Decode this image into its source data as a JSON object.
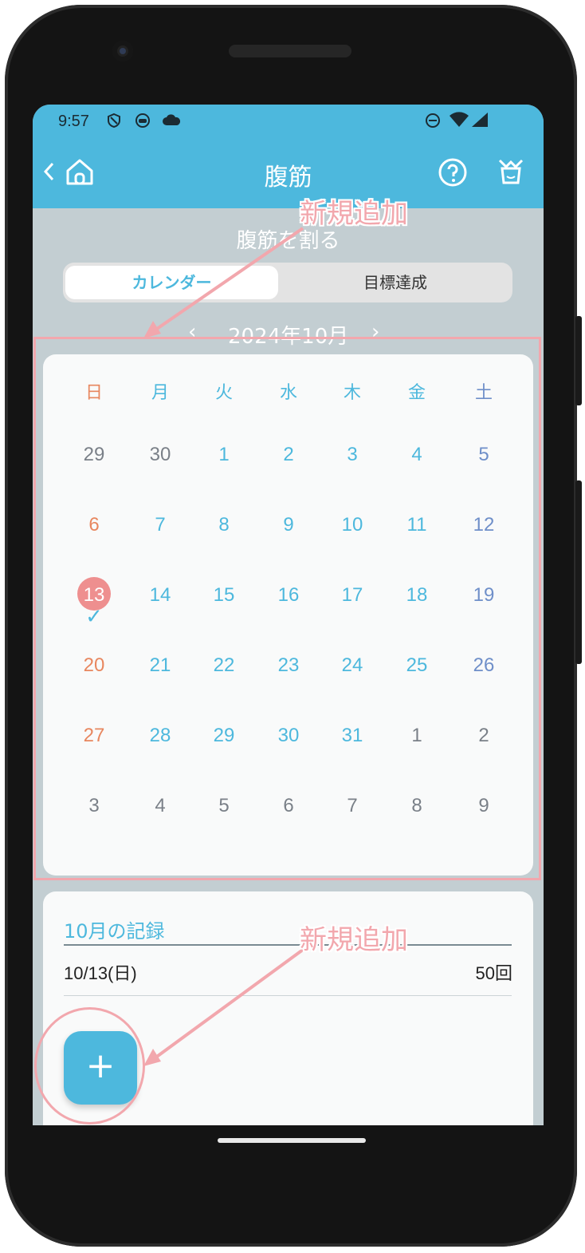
{
  "status_bar": {
    "time": "9:57"
  },
  "app_bar": {
    "title": "腹筋"
  },
  "page": {
    "subtitle": "腹筋を割る"
  },
  "segment": {
    "calendar_label": "カレンダー",
    "goal_label": "目標達成"
  },
  "month_nav": {
    "prev": "‹",
    "label": "2024年10月",
    "next": "›"
  },
  "calendar": {
    "weekdays": [
      "日",
      "月",
      "火",
      "水",
      "木",
      "金",
      "土"
    ],
    "weeks": [
      [
        "29",
        "30",
        "1",
        "2",
        "3",
        "4",
        "5"
      ],
      [
        "6",
        "7",
        "8",
        "9",
        "10",
        "11",
        "12"
      ],
      [
        "13",
        "14",
        "15",
        "16",
        "17",
        "18",
        "19"
      ],
      [
        "20",
        "21",
        "22",
        "23",
        "24",
        "25",
        "26"
      ],
      [
        "27",
        "28",
        "29",
        "30",
        "31",
        "1",
        "2"
      ],
      [
        "3",
        "4",
        "5",
        "6",
        "7",
        "8",
        "9"
      ]
    ],
    "today": "13",
    "today_check": "✓"
  },
  "records": {
    "title": "10月の記録",
    "items": [
      {
        "date": "10/13(日)",
        "count": "50回"
      }
    ]
  },
  "fab": {
    "label": "+"
  },
  "annotations": {
    "top_label": "新規追加",
    "bottom_label": "新規追加"
  },
  "colors": {
    "accent": "#4db8dd",
    "sunday": "#e8875f",
    "saturday": "#6f8fc9",
    "weekday": "#4db8dd",
    "other_month": "#7a8088",
    "today_circle": "#ee8f8f",
    "annotation": "#f2a7ad"
  }
}
